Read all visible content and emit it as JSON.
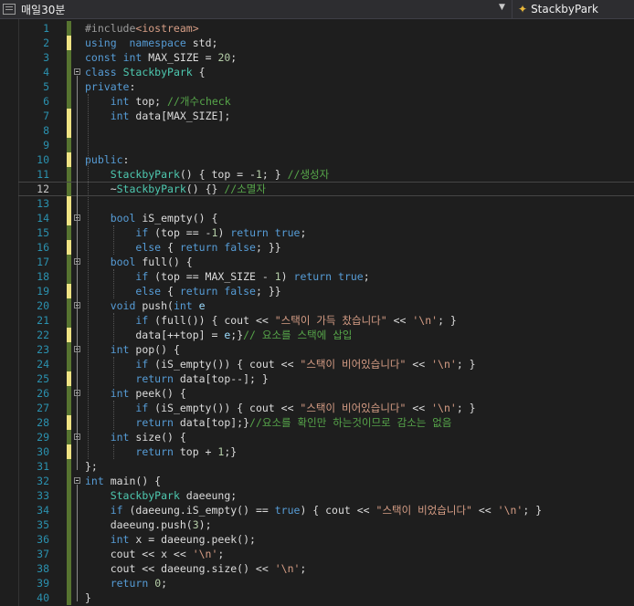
{
  "toolbar": {
    "scope_label": "매일30분",
    "member_label": "StackbyPark"
  },
  "editor": {
    "current_line": 12,
    "lines": [
      {
        "n": "1",
        "tokens": [
          [
            "p",
            "#include"
          ],
          [
            "s",
            "<iostream>"
          ]
        ],
        "change": "g"
      },
      {
        "n": "2",
        "tokens": [
          [
            "k",
            "using"
          ],
          [
            "",
            "  "
          ],
          [
            "k",
            "namespace"
          ],
          [
            "",
            " std;"
          ]
        ],
        "change": "y"
      },
      {
        "n": "3",
        "tokens": [
          [
            "k",
            "const"
          ],
          [
            "",
            " "
          ],
          [
            "k",
            "int"
          ],
          [
            "",
            " MAX_SIZE = "
          ],
          [
            "n",
            "20"
          ],
          [
            "",
            ";"
          ]
        ],
        "change": "g"
      },
      {
        "n": "4",
        "tokens": [
          [
            "k",
            "class"
          ],
          [
            "",
            " "
          ],
          [
            "t",
            "StackbyPark"
          ],
          [
            "",
            " {"
          ]
        ],
        "change": "g",
        "fold": true
      },
      {
        "n": "5",
        "tokens": [
          [
            "k",
            "private"
          ],
          [
            "",
            ":"
          ]
        ],
        "change": "g"
      },
      {
        "n": "6",
        "tokens": [
          [
            "",
            "    "
          ],
          [
            "k",
            "int"
          ],
          [
            "",
            " top; "
          ],
          [
            "c",
            "//개수check"
          ]
        ],
        "change": "g"
      },
      {
        "n": "7",
        "tokens": [
          [
            "",
            "    "
          ],
          [
            "k",
            "int"
          ],
          [
            "",
            " data[MAX_SIZE];"
          ]
        ],
        "change": "y"
      },
      {
        "n": "8",
        "tokens": [],
        "change": "y"
      },
      {
        "n": "9",
        "tokens": [],
        "change": "g"
      },
      {
        "n": "10",
        "tokens": [
          [
            "k",
            "public"
          ],
          [
            "",
            ":"
          ]
        ],
        "change": "y"
      },
      {
        "n": "11",
        "tokens": [
          [
            "",
            "    "
          ],
          [
            "t",
            "StackbyPark"
          ],
          [
            "",
            "() { top = -"
          ],
          [
            "n",
            "1"
          ],
          [
            "",
            "; } "
          ],
          [
            "c",
            "//생성자"
          ]
        ],
        "change": "g"
      },
      {
        "n": "12",
        "tokens": [
          [
            "",
            "    ~"
          ],
          [
            "t",
            "StackbyPark"
          ],
          [
            "",
            "() {} "
          ],
          [
            "c",
            "//소멸자"
          ]
        ],
        "change": "g"
      },
      {
        "n": "13",
        "tokens": [],
        "change": "y"
      },
      {
        "n": "14",
        "tokens": [
          [
            "",
            "    "
          ],
          [
            "k",
            "bool"
          ],
          [
            "",
            " iS_empty() {"
          ]
        ],
        "change": "y",
        "fold": true
      },
      {
        "n": "15",
        "tokens": [
          [
            "",
            "        "
          ],
          [
            "k",
            "if"
          ],
          [
            "",
            " (top == -"
          ],
          [
            "n",
            "1"
          ],
          [
            "",
            ") "
          ],
          [
            "k",
            "return"
          ],
          [
            "",
            " "
          ],
          [
            "k",
            "true"
          ],
          [
            "",
            ";"
          ]
        ],
        "change": "g"
      },
      {
        "n": "16",
        "tokens": [
          [
            "",
            "        "
          ],
          [
            "k",
            "else"
          ],
          [
            "",
            " { "
          ],
          [
            "k",
            "return"
          ],
          [
            "",
            " "
          ],
          [
            "k",
            "false"
          ],
          [
            "",
            "; }}"
          ]
        ],
        "change": "y"
      },
      {
        "n": "17",
        "tokens": [
          [
            "",
            "    "
          ],
          [
            "k",
            "bool"
          ],
          [
            "",
            " full() {"
          ]
        ],
        "change": "g",
        "fold": true
      },
      {
        "n": "18",
        "tokens": [
          [
            "",
            "        "
          ],
          [
            "k",
            "if"
          ],
          [
            "",
            " (top == MAX_SIZE - "
          ],
          [
            "n",
            "1"
          ],
          [
            "",
            ") "
          ],
          [
            "k",
            "return"
          ],
          [
            "",
            " "
          ],
          [
            "k",
            "true"
          ],
          [
            "",
            ";"
          ]
        ],
        "change": "g"
      },
      {
        "n": "19",
        "tokens": [
          [
            "",
            "        "
          ],
          [
            "k",
            "else"
          ],
          [
            "",
            " { "
          ],
          [
            "k",
            "return"
          ],
          [
            "",
            " "
          ],
          [
            "k",
            "false"
          ],
          [
            "",
            "; }}"
          ]
        ],
        "change": "y"
      },
      {
        "n": "20",
        "tokens": [
          [
            "",
            "    "
          ],
          [
            "k",
            "void"
          ],
          [
            "",
            " push("
          ],
          [
            "k",
            "int"
          ],
          [
            "",
            " "
          ],
          [
            "v",
            "e"
          ],
          [
            ") {"
          ]
        ],
        "change": "g",
        "fold": true
      },
      {
        "n": "21",
        "tokens": [
          [
            "",
            "        "
          ],
          [
            "k",
            "if"
          ],
          [
            "",
            " (full()) { cout << "
          ],
          [
            "s",
            "\"스택이 가득 찼습니다\""
          ],
          [
            "",
            " << "
          ],
          [
            "s",
            "'\\n'"
          ],
          [
            "",
            "; }"
          ]
        ],
        "change": "g"
      },
      {
        "n": "22",
        "tokens": [
          [
            "",
            "        data[++top] = "
          ],
          [
            "v",
            "e"
          ],
          [
            "",
            ";}"
          ],
          [
            "c",
            "// 요소를 스택에 삽입"
          ]
        ],
        "change": "y"
      },
      {
        "n": "23",
        "tokens": [
          [
            "",
            "    "
          ],
          [
            "k",
            "int"
          ],
          [
            "",
            " pop() {"
          ]
        ],
        "change": "g",
        "fold": true
      },
      {
        "n": "24",
        "tokens": [
          [
            "",
            "        "
          ],
          [
            "k",
            "if"
          ],
          [
            "",
            " (iS_empty()) { cout << "
          ],
          [
            "s",
            "\"스택이 비어있습니다\""
          ],
          [
            "",
            " << "
          ],
          [
            "s",
            "'\\n'"
          ],
          [
            "",
            "; }"
          ]
        ],
        "change": "g"
      },
      {
        "n": "25",
        "tokens": [
          [
            "",
            "        "
          ],
          [
            "k",
            "return"
          ],
          [
            "",
            " data[top--]; }"
          ]
        ],
        "change": "y"
      },
      {
        "n": "26",
        "tokens": [
          [
            "",
            "    "
          ],
          [
            "k",
            "int"
          ],
          [
            "",
            " peek() {"
          ]
        ],
        "change": "g",
        "fold": true
      },
      {
        "n": "27",
        "tokens": [
          [
            "",
            "        "
          ],
          [
            "k",
            "if"
          ],
          [
            "",
            " (iS_empty()) { cout << "
          ],
          [
            "s",
            "\"스택이 비어있습니다\""
          ],
          [
            "",
            " << "
          ],
          [
            "s",
            "'\\n'"
          ],
          [
            "",
            "; }"
          ]
        ],
        "change": "g"
      },
      {
        "n": "28",
        "tokens": [
          [
            "",
            "        "
          ],
          [
            "k",
            "return"
          ],
          [
            "",
            " data[top];}"
          ],
          [
            "c",
            "//요소를 확인만 하는것이므로 감소는 없음"
          ]
        ],
        "change": "y"
      },
      {
        "n": "29",
        "tokens": [
          [
            "",
            "    "
          ],
          [
            "k",
            "int"
          ],
          [
            "",
            " size() {"
          ]
        ],
        "change": "g",
        "fold": true
      },
      {
        "n": "30",
        "tokens": [
          [
            "",
            "        "
          ],
          [
            "k",
            "return"
          ],
          [
            "",
            " top + "
          ],
          [
            "n",
            "1"
          ],
          [
            "",
            ";}"
          ]
        ],
        "change": "y"
      },
      {
        "n": "31",
        "tokens": [
          [
            "",
            "};"
          ]
        ],
        "change": "g"
      },
      {
        "n": "32",
        "tokens": [
          [
            "k",
            "int"
          ],
          [
            "",
            " main() {"
          ]
        ],
        "change": "g",
        "fold": true
      },
      {
        "n": "33",
        "tokens": [
          [
            "",
            "    "
          ],
          [
            "t",
            "StackbyPark"
          ],
          [
            "",
            " daeeung;"
          ]
        ],
        "change": "g"
      },
      {
        "n": "34",
        "tokens": [
          [
            "",
            "    "
          ],
          [
            "k",
            "if"
          ],
          [
            "",
            " (daeeung.iS_empty() == "
          ],
          [
            "k",
            "true"
          ],
          [
            "",
            ") { cout << "
          ],
          [
            "s",
            "\"스택이 비었습니다\""
          ],
          [
            "",
            " << "
          ],
          [
            "s",
            "'\\n'"
          ],
          [
            "",
            "; }"
          ]
        ],
        "change": "g"
      },
      {
        "n": "35",
        "tokens": [
          [
            "",
            "    daeeung.push("
          ],
          [
            "n",
            "3"
          ],
          [
            "",
            ");"
          ]
        ],
        "change": "g"
      },
      {
        "n": "36",
        "tokens": [
          [
            "",
            "    "
          ],
          [
            "k",
            "int"
          ],
          [
            "",
            " x = daeeung.peek();"
          ]
        ],
        "change": "g"
      },
      {
        "n": "37",
        "tokens": [
          [
            "",
            "    cout << x << "
          ],
          [
            "s",
            "'\\n'"
          ],
          [
            "",
            ";"
          ]
        ],
        "change": "g"
      },
      {
        "n": "38",
        "tokens": [
          [
            "",
            "    cout << daeeung.size() << "
          ],
          [
            "s",
            "'\\n'"
          ],
          [
            "",
            ";"
          ]
        ],
        "change": "g"
      },
      {
        "n": "39",
        "tokens": [
          [
            "",
            "    "
          ],
          [
            "k",
            "return"
          ],
          [
            "",
            " "
          ],
          [
            "n",
            "0"
          ],
          [
            "",
            ";"
          ]
        ],
        "change": "g"
      },
      {
        "n": "40",
        "tokens": [
          [
            "",
            "}"
          ]
        ],
        "change": "g"
      }
    ]
  }
}
